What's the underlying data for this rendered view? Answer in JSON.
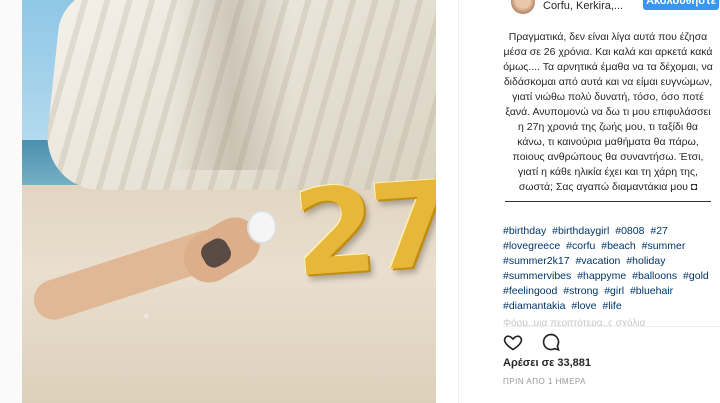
{
  "header": {
    "location": "Corfu, Kerkira,...",
    "follow_label": "Ακολουθήστε"
  },
  "caption": {
    "text": "Πραγματικά, δεν είναι λίγα αυτά που έζησα μέσα σε 26 χρόνια. Και καλά και αρκετά κακά όμως.... Τα αρνητικά έμαθα να τα δέχομαι, να διδάσκομαι από αυτά και να είμαι ευγνώμων, γιατί νιώθω πολύ δυνατή, τόσο, όσο ποτέ ξανά. Ανυπομονώ να δω τι μου επιφυλάσσει η 27η χρονιά της ζωής μου, τι ταξίδι θα κάνω, τι καινούρια μαθήματα θα πάρω, ποιους ανθρώπους θα συναντήσω. Έτσι, γιατί η κάθε ηλικία έχει και τη χάρη της, σωστά; Σας αγαπώ διαμαντάκια μου ◘",
    "hashtags": [
      "#birthday",
      "#birthdaygirl",
      "#0808",
      "#27",
      "#lovegreece",
      "#corfu",
      "#beach",
      "#summer",
      "#summer2k17",
      "#vacation",
      "#holiday",
      "#summervibes",
      "#happyme",
      "#balloons",
      "#gold",
      "#feelingood",
      "#strong",
      "#girl",
      "#bluehair",
      "#diamantakia",
      "#love",
      "#life"
    ],
    "faded": "Φόρμ..μια περιττότερα..ς σχόλια"
  },
  "photo": {
    "balloon_number": "27"
  },
  "stats": {
    "likes": "Αρέσει σε 33,881",
    "time": "ΠΡΙΝ ΑΠΟ 1 ΗΜΕΡΑ"
  },
  "icons": {
    "like": "heart-icon",
    "comment": "comment-icon"
  },
  "colors": {
    "accent": "#3897f0",
    "hashtag": "#003569",
    "balloon": "#e7b73a"
  }
}
